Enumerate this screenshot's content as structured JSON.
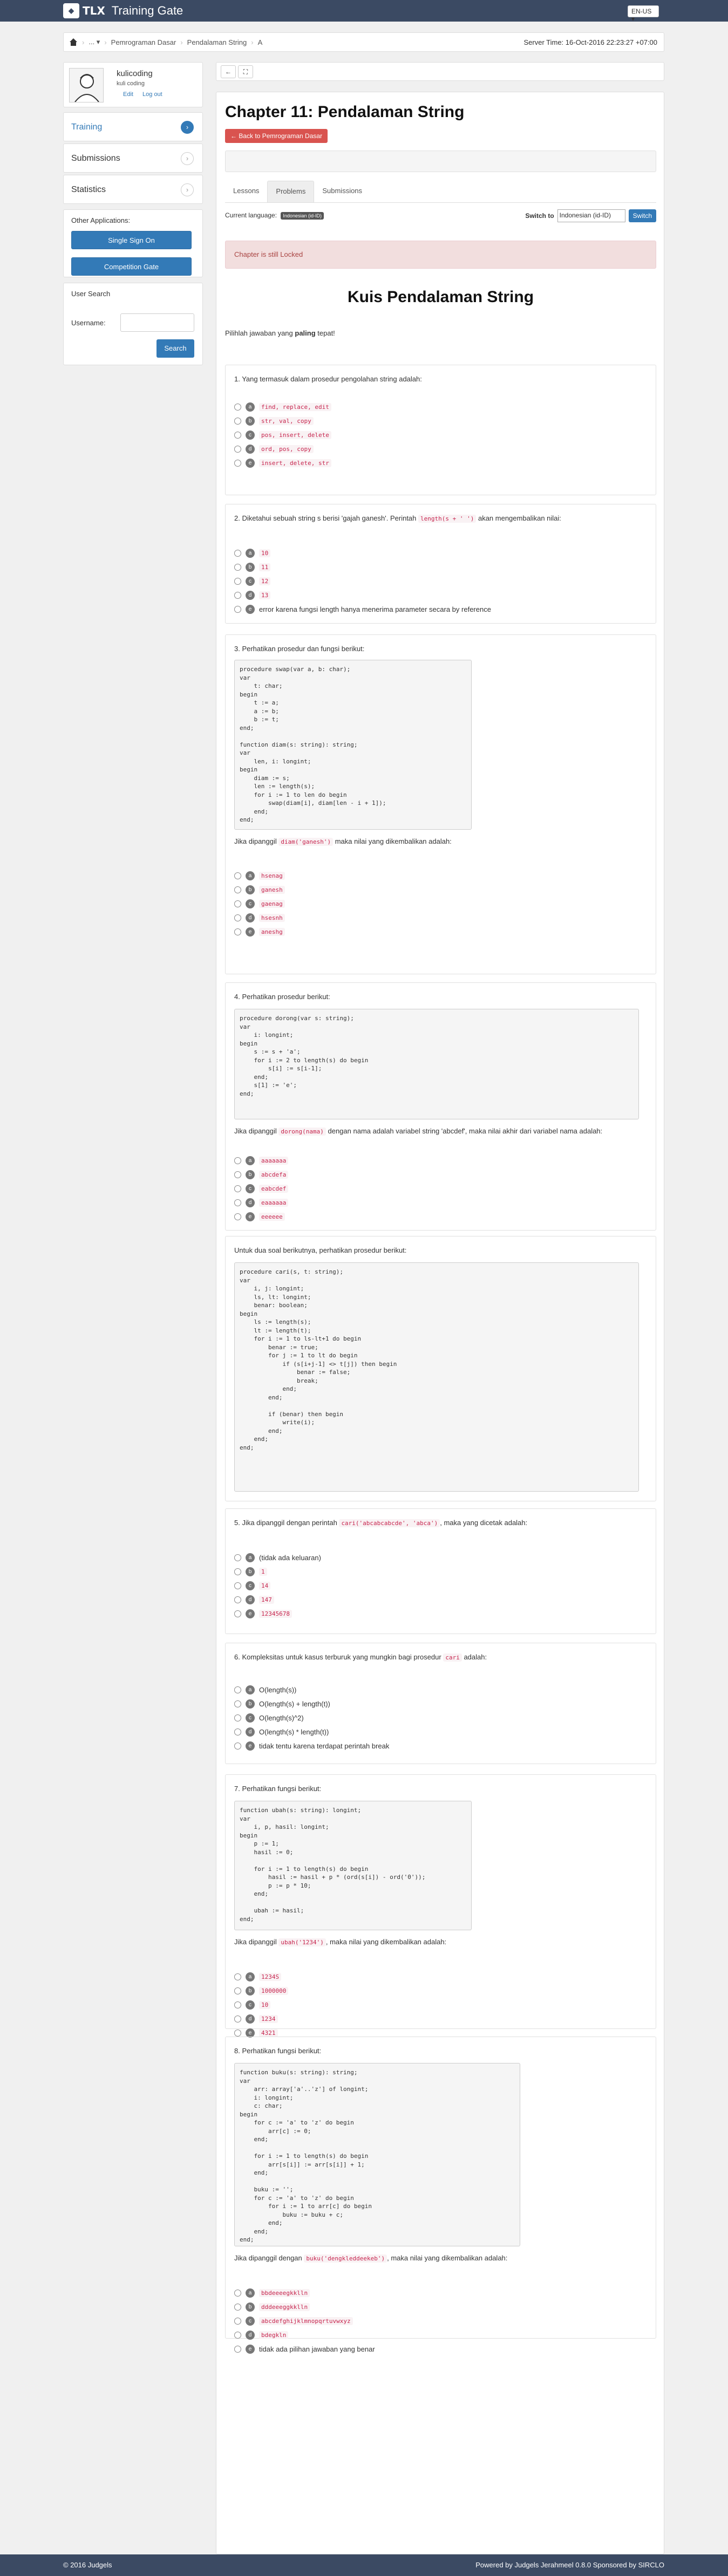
{
  "header": {
    "logo_tlx": "TLX",
    "app_title": "Training Gate",
    "lang": "EN-US ▾"
  },
  "breadcrumb": {
    "dots": "... ▾",
    "items": [
      "Pemrograman Dasar",
      "Pendalaman String",
      "A"
    ],
    "server_time": "Server Time: 16-Oct-2016 22:23:27 +07:00"
  },
  "profile": {
    "name": "kulicoding",
    "subtitle": "kuli coding",
    "edit": "Edit",
    "logout": "Log out"
  },
  "menu": [
    {
      "label": "Training",
      "icon": "chevron-right-icon"
    },
    {
      "label": "Submissions",
      "icon": "chevron-right-icon"
    },
    {
      "label": "Statistics",
      "icon": "chevron-right-icon"
    }
  ],
  "other_apps": {
    "title": "Other Applications:",
    "sso": "Single Sign On",
    "competition": "Competition Gate"
  },
  "user_search": {
    "title": "User Search",
    "label": "Username:",
    "button": "Search"
  },
  "chapter": {
    "title": "Chapter 11: Pendalaman String",
    "back": "← Back to Pemrograman Dasar"
  },
  "tabs": [
    "Lessons",
    "Problems",
    "Submissions"
  ],
  "language": {
    "current_label": "Current language:",
    "current_badge": "Indonesian (id-ID)",
    "switch_label": "Switch to",
    "switch_value": "Indonesian (id-ID)",
    "switch_button": "Switch"
  },
  "locked": "Chapter is still Locked",
  "quiz_title": "Kuis Pendalaman String",
  "intro_pre": "Pilihlah jawaban yang ",
  "intro_bold": "paling",
  "intro_post": " tepat!",
  "q1": {
    "text": "1. Yang termasuk dalam prosedur pengolahan string adalah:",
    "options": [
      {
        "l": "a",
        "t": "find, replace, edit"
      },
      {
        "l": "b",
        "t": "str, val, copy"
      },
      {
        "l": "c",
        "t": "pos, insert, delete"
      },
      {
        "l": "d",
        "t": "ord, pos, copy"
      },
      {
        "l": "e",
        "t": "insert, delete, str"
      }
    ]
  },
  "q2": {
    "pre": "2. Diketahui sebuah string s berisi 'gajah ganesh'. Perintah ",
    "code": "length(s + ' ')",
    "post": " akan mengembalikan nilai:",
    "options": [
      {
        "l": "a",
        "t": "10"
      },
      {
        "l": "b",
        "t": "11"
      },
      {
        "l": "c",
        "t": "12"
      },
      {
        "l": "d",
        "t": "13"
      },
      {
        "l": "e",
        "t": "error karena fungsi length hanya menerima parameter secara by reference"
      }
    ]
  },
  "q3": {
    "text": "3. Perhatikan prosedur dan fungsi berikut:",
    "code": "procedure swap(var a, b: char);\nvar\n    t: char;\nbegin\n    t := a;\n    a := b;\n    b := t;\nend;\n\nfunction diam(s: string): string;\nvar\n    len, i: longint;\nbegin\n    diam := s;\n    len := length(s);\n    for i := 1 to len do begin\n        swap(diam[i], diam[len - i + 1]);\n    end;\nend;",
    "q_pre": "Jika dipanggil ",
    "q_code": "diam('ganesh')",
    "q_post": " maka nilai yang dikembalikan adalah:",
    "options": [
      {
        "l": "a",
        "t": "hsenag"
      },
      {
        "l": "b",
        "t": "ganesh"
      },
      {
        "l": "c",
        "t": "gaenag"
      },
      {
        "l": "d",
        "t": "hsesnh"
      },
      {
        "l": "e",
        "t": "aneshg"
      }
    ]
  },
  "q4": {
    "text": "4. Perhatikan prosedur berikut:",
    "code": "procedure dorong(var s: string);\nvar\n    i: longint;\nbegin\n    s := s + 'a';\n    for i := 2 to length(s) do begin\n        s[i] := s[i-1];\n    end;\n    s[1] := 'e';\nend;",
    "q_pre": "Jika dipanggil ",
    "q_code": "dorong(nama)",
    "q_post": " dengan nama adalah variabel string 'abcdef', maka nilai akhir dari variabel nama adalah:",
    "options": [
      {
        "l": "a",
        "t": "aaaaaaa"
      },
      {
        "l": "b",
        "t": "abcdefa"
      },
      {
        "l": "c",
        "t": "eabcdef"
      },
      {
        "l": "d",
        "t": "eaaaaaa"
      },
      {
        "l": "e",
        "t": "eeeeee"
      }
    ]
  },
  "q5intro": {
    "text": "Untuk dua soal berikutnya, perhatikan prosedur berikut:",
    "code": "procedure cari(s, t: string);\nvar\n    i, j: longint;\n    ls, lt: longint;\n    benar: boolean;\nbegin\n    ls := length(s);\n    lt := length(t);\n    for i := 1 to ls-lt+1 do begin\n        benar := true;\n        for j := 1 to lt do begin\n            if (s[i+j-1] <> t[j]) then begin\n                benar := false;\n                break;\n            end;\n        end;\n\n        if (benar) then begin\n            write(i);\n        end;\n    end;\nend;"
  },
  "q5": {
    "pre": "5. Jika dipanggil dengan perintah ",
    "code": "cari('abcabcabcde', 'abca')",
    "post": ", maka yang dicetak adalah:",
    "options": [
      {
        "l": "a",
        "t": "(tidak ada keluaran)"
      },
      {
        "l": "b",
        "t": "1"
      },
      {
        "l": "c",
        "t": "14"
      },
      {
        "l": "d",
        "t": "147"
      },
      {
        "l": "e",
        "t": "12345678"
      }
    ]
  },
  "q6": {
    "pre": "6. Kompleksitas untuk kasus terburuk yang mungkin bagi prosedur ",
    "code": "cari",
    "post": " adalah:",
    "options": [
      {
        "l": "a",
        "t": "O(length(s))"
      },
      {
        "l": "b",
        "t": "O(length(s) + length(t))"
      },
      {
        "l": "c",
        "t": "O(length(s)^2)"
      },
      {
        "l": "d",
        "t": "O(length(s) * length(t))"
      },
      {
        "l": "e",
        "t": "tidak tentu karena terdapat perintah break"
      }
    ]
  },
  "q7": {
    "text": "7. Perhatikan fungsi berikut:",
    "code": "function ubah(s: string): longint;\nvar\n    i, p, hasil: longint;\nbegin\n    p := 1;\n    hasil := 0;\n\n    for i := 1 to length(s) do begin\n        hasil := hasil + p * (ord(s[i]) - ord('0'));\n        p := p * 10;\n    end;\n\n    ubah := hasil;\nend;",
    "q_pre": "Jika dipanggil ",
    "q_code": "ubah('1234')",
    "q_post": ", maka nilai yang dikembalikan adalah:",
    "options": [
      {
        "l": "a",
        "t": "1234S"
      },
      {
        "l": "b",
        "t": "1000000"
      },
      {
        "l": "c",
        "t": "10"
      },
      {
        "l": "d",
        "t": "1234"
      },
      {
        "l": "e",
        "t": "4321"
      }
    ]
  },
  "q8": {
    "text": "8. Perhatikan fungsi berikut:",
    "code": "function buku(s: string): string;\nvar\n    arr: array['a'..'z'] of longint;\n    i: longint;\n    c: char;\nbegin\n    for c := 'a' to 'z' do begin\n        arr[c] := 0;\n    end;\n\n    for i := 1 to length(s) do begin\n        arr[s[i]] := arr[s[i]] + 1;\n    end;\n\n    buku := '';\n    for c := 'a' to 'z' do begin\n        for i := 1 to arr[c] do begin\n            buku := buku + c;\n        end;\n    end;\nend;",
    "q_pre": "Jika dipanggil dengan ",
    "q_code": "buku('dengkleddeekeb')",
    "q_post": ", maka nilai yang dikembalikan adalah:",
    "options": [
      {
        "l": "a",
        "t": "bbdeeeegkklln"
      },
      {
        "l": "b",
        "t": "dddeeeggkklln"
      },
      {
        "l": "c",
        "t": "abcdefghijklmnopqrtuvwxyz"
      },
      {
        "l": "d",
        "t": "bdegkln"
      },
      {
        "l": "e",
        "t": "tidak ada pilihan jawaban yang benar"
      }
    ]
  },
  "footer": {
    "left": "© 2016 Judgels",
    "right": "Powered by Judgels Jerahmeel 0.8.0 Sponsored by SIRCLO"
  }
}
